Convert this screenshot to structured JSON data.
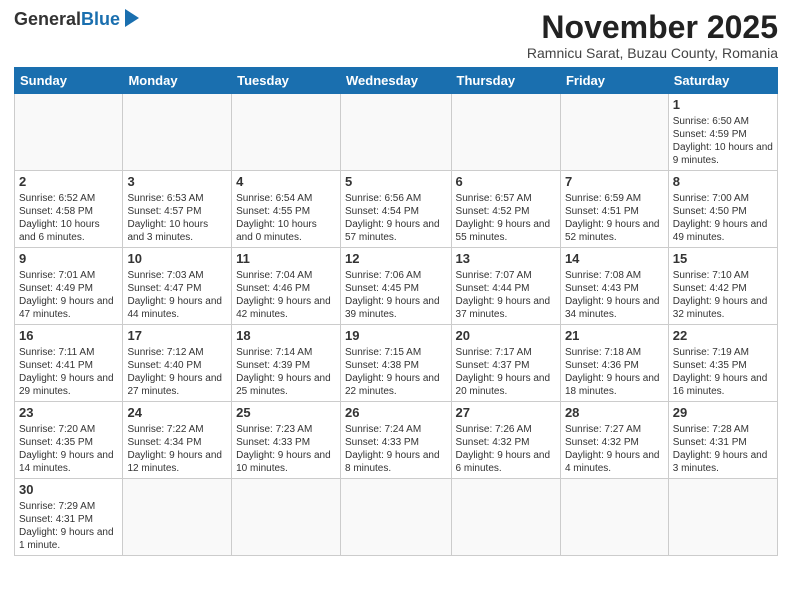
{
  "logo": {
    "text_general": "General",
    "text_blue": "Blue"
  },
  "title": {
    "month": "November 2025",
    "location": "Ramnicu Sarat, Buzau County, Romania"
  },
  "days_of_week": [
    "Sunday",
    "Monday",
    "Tuesday",
    "Wednesday",
    "Thursday",
    "Friday",
    "Saturday"
  ],
  "weeks": [
    [
      {
        "day": "",
        "info": ""
      },
      {
        "day": "",
        "info": ""
      },
      {
        "day": "",
        "info": ""
      },
      {
        "day": "",
        "info": ""
      },
      {
        "day": "",
        "info": ""
      },
      {
        "day": "",
        "info": ""
      },
      {
        "day": "1",
        "info": "Sunrise: 6:50 AM\nSunset: 4:59 PM\nDaylight: 10 hours and 9 minutes."
      }
    ],
    [
      {
        "day": "2",
        "info": "Sunrise: 6:52 AM\nSunset: 4:58 PM\nDaylight: 10 hours and 6 minutes."
      },
      {
        "day": "3",
        "info": "Sunrise: 6:53 AM\nSunset: 4:57 PM\nDaylight: 10 hours and 3 minutes."
      },
      {
        "day": "4",
        "info": "Sunrise: 6:54 AM\nSunset: 4:55 PM\nDaylight: 10 hours and 0 minutes."
      },
      {
        "day": "5",
        "info": "Sunrise: 6:56 AM\nSunset: 4:54 PM\nDaylight: 9 hours and 57 minutes."
      },
      {
        "day": "6",
        "info": "Sunrise: 6:57 AM\nSunset: 4:52 PM\nDaylight: 9 hours and 55 minutes."
      },
      {
        "day": "7",
        "info": "Sunrise: 6:59 AM\nSunset: 4:51 PM\nDaylight: 9 hours and 52 minutes."
      },
      {
        "day": "8",
        "info": "Sunrise: 7:00 AM\nSunset: 4:50 PM\nDaylight: 9 hours and 49 minutes."
      }
    ],
    [
      {
        "day": "9",
        "info": "Sunrise: 7:01 AM\nSunset: 4:49 PM\nDaylight: 9 hours and 47 minutes."
      },
      {
        "day": "10",
        "info": "Sunrise: 7:03 AM\nSunset: 4:47 PM\nDaylight: 9 hours and 44 minutes."
      },
      {
        "day": "11",
        "info": "Sunrise: 7:04 AM\nSunset: 4:46 PM\nDaylight: 9 hours and 42 minutes."
      },
      {
        "day": "12",
        "info": "Sunrise: 7:06 AM\nSunset: 4:45 PM\nDaylight: 9 hours and 39 minutes."
      },
      {
        "day": "13",
        "info": "Sunrise: 7:07 AM\nSunset: 4:44 PM\nDaylight: 9 hours and 37 minutes."
      },
      {
        "day": "14",
        "info": "Sunrise: 7:08 AM\nSunset: 4:43 PM\nDaylight: 9 hours and 34 minutes."
      },
      {
        "day": "15",
        "info": "Sunrise: 7:10 AM\nSunset: 4:42 PM\nDaylight: 9 hours and 32 minutes."
      }
    ],
    [
      {
        "day": "16",
        "info": "Sunrise: 7:11 AM\nSunset: 4:41 PM\nDaylight: 9 hours and 29 minutes."
      },
      {
        "day": "17",
        "info": "Sunrise: 7:12 AM\nSunset: 4:40 PM\nDaylight: 9 hours and 27 minutes."
      },
      {
        "day": "18",
        "info": "Sunrise: 7:14 AM\nSunset: 4:39 PM\nDaylight: 9 hours and 25 minutes."
      },
      {
        "day": "19",
        "info": "Sunrise: 7:15 AM\nSunset: 4:38 PM\nDaylight: 9 hours and 22 minutes."
      },
      {
        "day": "20",
        "info": "Sunrise: 7:17 AM\nSunset: 4:37 PM\nDaylight: 9 hours and 20 minutes."
      },
      {
        "day": "21",
        "info": "Sunrise: 7:18 AM\nSunset: 4:36 PM\nDaylight: 9 hours and 18 minutes."
      },
      {
        "day": "22",
        "info": "Sunrise: 7:19 AM\nSunset: 4:35 PM\nDaylight: 9 hours and 16 minutes."
      }
    ],
    [
      {
        "day": "23",
        "info": "Sunrise: 7:20 AM\nSunset: 4:35 PM\nDaylight: 9 hours and 14 minutes."
      },
      {
        "day": "24",
        "info": "Sunrise: 7:22 AM\nSunset: 4:34 PM\nDaylight: 9 hours and 12 minutes."
      },
      {
        "day": "25",
        "info": "Sunrise: 7:23 AM\nSunset: 4:33 PM\nDaylight: 9 hours and 10 minutes."
      },
      {
        "day": "26",
        "info": "Sunrise: 7:24 AM\nSunset: 4:33 PM\nDaylight: 9 hours and 8 minutes."
      },
      {
        "day": "27",
        "info": "Sunrise: 7:26 AM\nSunset: 4:32 PM\nDaylight: 9 hours and 6 minutes."
      },
      {
        "day": "28",
        "info": "Sunrise: 7:27 AM\nSunset: 4:32 PM\nDaylight: 9 hours and 4 minutes."
      },
      {
        "day": "29",
        "info": "Sunrise: 7:28 AM\nSunset: 4:31 PM\nDaylight: 9 hours and 3 minutes."
      }
    ],
    [
      {
        "day": "30",
        "info": "Sunrise: 7:29 AM\nSunset: 4:31 PM\nDaylight: 9 hours and 1 minute."
      },
      {
        "day": "",
        "info": ""
      },
      {
        "day": "",
        "info": ""
      },
      {
        "day": "",
        "info": ""
      },
      {
        "day": "",
        "info": ""
      },
      {
        "day": "",
        "info": ""
      },
      {
        "day": "",
        "info": ""
      }
    ]
  ]
}
